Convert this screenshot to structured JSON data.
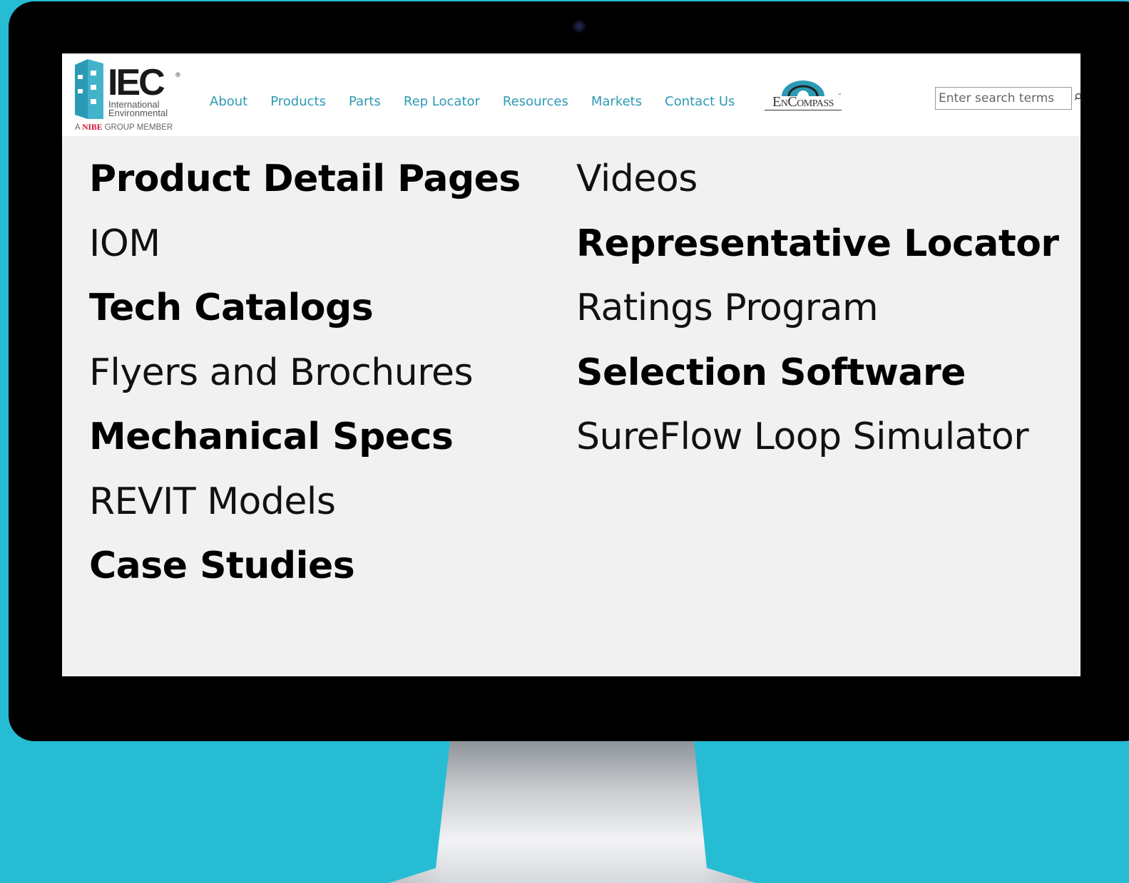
{
  "header": {
    "logo": {
      "name": "IEC",
      "registered": "®",
      "line1": "International",
      "line2": "Environmental",
      "tag_prefix": "A",
      "tag_brand": "NIBE",
      "tag_suffix": "GROUP MEMBER"
    },
    "nav": [
      "About",
      "Products",
      "Parts",
      "Rep Locator",
      "Resources",
      "Markets",
      "Contact Us"
    ],
    "partner_logo": "EnCompass",
    "partner_tm": "™",
    "search": {
      "placeholder": "Enter search terms",
      "value": ""
    }
  },
  "content": {
    "left_column": [
      {
        "label": "Product Detail Pages",
        "weight": "bold"
      },
      {
        "label": "IOM",
        "weight": "light"
      },
      {
        "label": "Tech Catalogs",
        "weight": "bold"
      },
      {
        "label": "Flyers and Brochures",
        "weight": "light"
      },
      {
        "label": "Mechanical Specs",
        "weight": "bold"
      },
      {
        "label": "REVIT Models",
        "weight": "light"
      },
      {
        "label": "Case Studies",
        "weight": "bold"
      }
    ],
    "right_column": [
      {
        "label": "Videos",
        "weight": "light"
      },
      {
        "label": "Representative Locator",
        "weight": "bold"
      },
      {
        "label": "Ratings Program",
        "weight": "light"
      },
      {
        "label": "Selection Software",
        "weight": "bold"
      },
      {
        "label": "SureFlow Loop Simulator",
        "weight": "light"
      }
    ]
  },
  "colors": {
    "background": "#26bcd4",
    "bezel": "#000000",
    "nav_link": "#2e9ab3",
    "logo_mark": "#2b9bb5",
    "brand_red": "#c8102e",
    "screen_bg": "#f1f1f1"
  },
  "icons": [
    "search-icon",
    "gear-icon",
    "camera-icon"
  ]
}
